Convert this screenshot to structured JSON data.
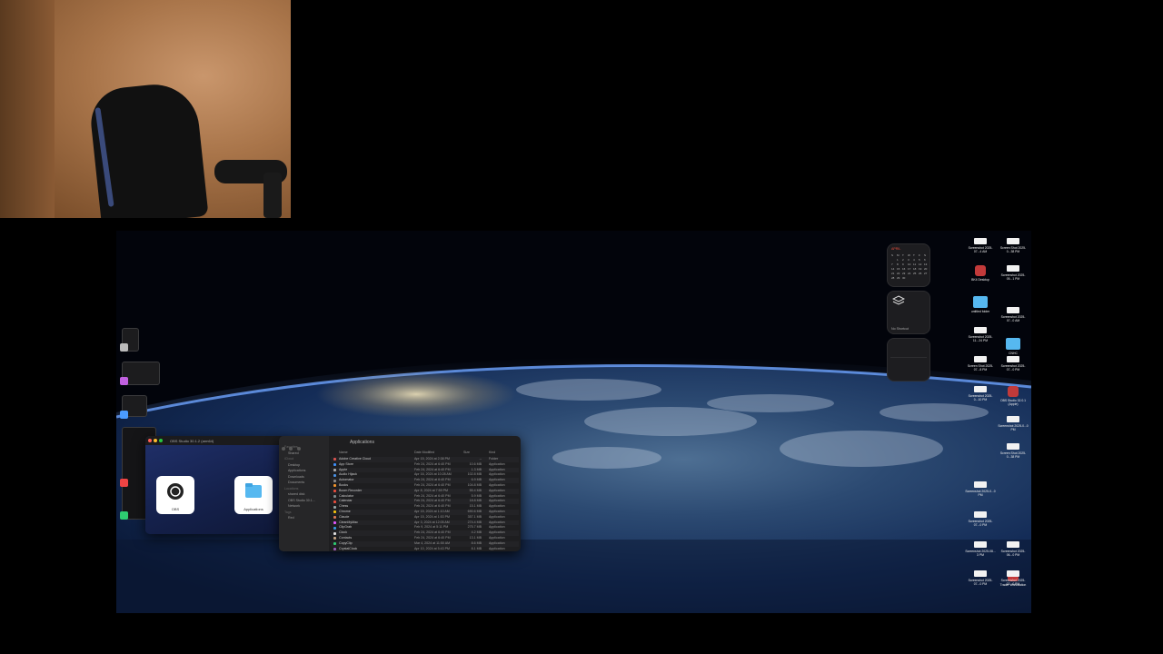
{
  "webcam": {
    "name": "webcam-overlay"
  },
  "obs_window": {
    "title": "OBS Studio 30.1.2 (arm64)",
    "tile_obs_label": "OBS",
    "tile_folder_label": "Applications"
  },
  "finder": {
    "title": "Applications",
    "sidebar": [
      {
        "label": "Favorites",
        "section": true
      },
      {
        "label": "Shared",
        "section": false
      },
      {
        "label": "iCloud",
        "section": true
      },
      {
        "label": "Desktop",
        "section": false
      },
      {
        "label": "Applications",
        "section": false
      },
      {
        "label": "Downloads",
        "section": false
      },
      {
        "label": "Documents",
        "section": false
      },
      {
        "label": "Locations",
        "section": true
      },
      {
        "label": "shared disk",
        "section": false
      },
      {
        "label": "OBS Studio 30.1...",
        "section": false
      },
      {
        "label": "Network",
        "section": false
      },
      {
        "label": "Tags",
        "section": true
      },
      {
        "label": "Red",
        "section": false
      }
    ],
    "columns": {
      "name": "Name",
      "date": "Date Modified",
      "size": "Size",
      "kind": "Kind"
    },
    "rows": [
      {
        "name": "Adobe Creative Cloud",
        "date": "Apr 15, 2024 at 2:38 PM",
        "size": "--",
        "kind": "Folder",
        "color": "#d9534f"
      },
      {
        "name": "App Store",
        "date": "Feb 24, 2024 at 6:40 PM",
        "size": "10.6 MB",
        "kind": "Application",
        "color": "#3e8ef7"
      },
      {
        "name": "Apple",
        "date": "Feb 24, 2024 at 6:40 PM",
        "size": "1.3 MB",
        "kind": "Application",
        "color": "#aaaaaa"
      },
      {
        "name": "Audio Hijack",
        "date": "Apr 16, 2024 at 10:28 AM",
        "size": "102.8 MB",
        "kind": "Application",
        "color": "#4a90e2"
      },
      {
        "name": "Automator",
        "date": "Feb 24, 2024 at 6:40 PM",
        "size": "6.9 MB",
        "kind": "Application",
        "color": "#888888"
      },
      {
        "name": "Books",
        "date": "Feb 24, 2024 at 6:40 PM",
        "size": "104.8 MB",
        "kind": "Application",
        "color": "#f0932b"
      },
      {
        "name": "Boom Recorder",
        "date": "Apr 8, 2024 at 7:59 PM",
        "size": "55.4 MB",
        "kind": "Application",
        "color": "#e74c3c"
      },
      {
        "name": "Calculator",
        "date": "Feb 24, 2024 at 6:40 PM",
        "size": "5.9 MB",
        "kind": "Application",
        "color": "#7f8c8d"
      },
      {
        "name": "Calendar",
        "date": "Feb 24, 2024 at 6:40 PM",
        "size": "18.8 MB",
        "kind": "Application",
        "color": "#e74c3c"
      },
      {
        "name": "Chess",
        "date": "Feb 24, 2024 at 6:40 PM",
        "size": "15.1 MB",
        "kind": "Application",
        "color": "#95a5a6"
      },
      {
        "name": "Chrome",
        "date": "Apr 15, 2024 at 1:10 AM",
        "size": "690.6 MB",
        "kind": "Application",
        "color": "#f4c20d"
      },
      {
        "name": "Claude",
        "date": "Apr 15, 2024 at 1:53 PM",
        "size": "357.1 MB",
        "kind": "Application",
        "color": "#d97757"
      },
      {
        "name": "CleanMyMac",
        "date": "Apr 3, 2024 at 12:05 AM",
        "size": "274.4 MB",
        "kind": "Application",
        "color": "#e056fd"
      },
      {
        "name": "ClipGrab",
        "date": "Feb 9, 2024 at 5:11 PM",
        "size": "275.7 MB",
        "kind": "Application",
        "color": "#3498db"
      },
      {
        "name": "Clock",
        "date": "Feb 24, 2024 at 6:40 PM",
        "size": "4.2 MB",
        "kind": "Application",
        "color": "#dddddd"
      },
      {
        "name": "Contacts",
        "date": "Feb 24, 2024 at 6:40 PM",
        "size": "13.1 MB",
        "kind": "Application",
        "color": "#c0a080"
      },
      {
        "name": "CopyClip",
        "date": "Mar 4, 2024 at 11:50 AM",
        "size": "8.6 MB",
        "kind": "Application",
        "color": "#2ecc71"
      },
      {
        "name": "CrystalClock",
        "date": "Apr 10, 2024 at 5:43 PM",
        "size": "8.1 MB",
        "kind": "Application",
        "color": "#9b59b6"
      }
    ]
  },
  "widgets": {
    "calendar_month": "APRIL",
    "calendar_days": [
      "S",
      "M",
      "T",
      "W",
      "T",
      "F",
      "S",
      "",
      "1",
      "2",
      "3",
      "4",
      "5",
      "6",
      "7",
      "8",
      "9",
      "10",
      "11",
      "12",
      "13",
      "14",
      "15",
      "16",
      "17",
      "18",
      "19",
      "20",
      "21",
      "22",
      "23",
      "24",
      "25",
      "26",
      "27",
      "28",
      "29",
      "30",
      "",
      "",
      "",
      ""
    ],
    "workspace_label": "No Shortcut"
  },
  "desktop_items": [
    {
      "label": "Screenshot 2025-07...4 AM",
      "kind": "thumb"
    },
    {
      "label": "Screen Shot 2025-0...38 PM",
      "kind": "thumb"
    },
    {
      "label": "BK4 Desktop",
      "kind": "app"
    },
    {
      "label": "Screenshot 2025-05...1 PM",
      "kind": "thumb"
    },
    {
      "label": "untitled folder",
      "kind": "folder"
    },
    {
      "label": "Screenshot 2025-11...24 PM",
      "kind": "thumb"
    },
    {
      "label": "Screenshot 2025-07...0 AM",
      "kind": "thumb"
    },
    {
      "label": "CNHC",
      "kind": "folder"
    },
    {
      "label": "Screen Shot 2025-07...8 PM",
      "kind": "thumb"
    },
    {
      "label": "Screenshot 2025-07...0 PM",
      "kind": "thumb"
    },
    {
      "label": "Screenshot 2025-0...10 PM",
      "kind": "thumb"
    },
    {
      "label": "OBS Studio 32.0.1 (Apple)",
      "kind": "app"
    },
    {
      "label": "Screenshot 2025-0...0 PM",
      "kind": "thumb"
    },
    {
      "label": "Screen Shot 2025-0...38 PM",
      "kind": "thumb"
    },
    {
      "label": "Screenshot 2025-0...0 PM",
      "kind": "thumb"
    },
    {
      "label": "Screenshot 2025-07...0 PM",
      "kind": "thumb"
    },
    {
      "label": "Screenshot 2025-06...0 PM",
      "kind": "thumb"
    },
    {
      "label": "Screenshot 2025-08... 3 PM",
      "kind": "thumb"
    },
    {
      "label": "Screenshot 2025-07...0 PM",
      "kind": "thumb"
    },
    {
      "label": "Trader Workstation",
      "kind": "app"
    },
    {
      "label": "Screenshot 2025-07...0 PM",
      "kind": "thumb"
    }
  ]
}
